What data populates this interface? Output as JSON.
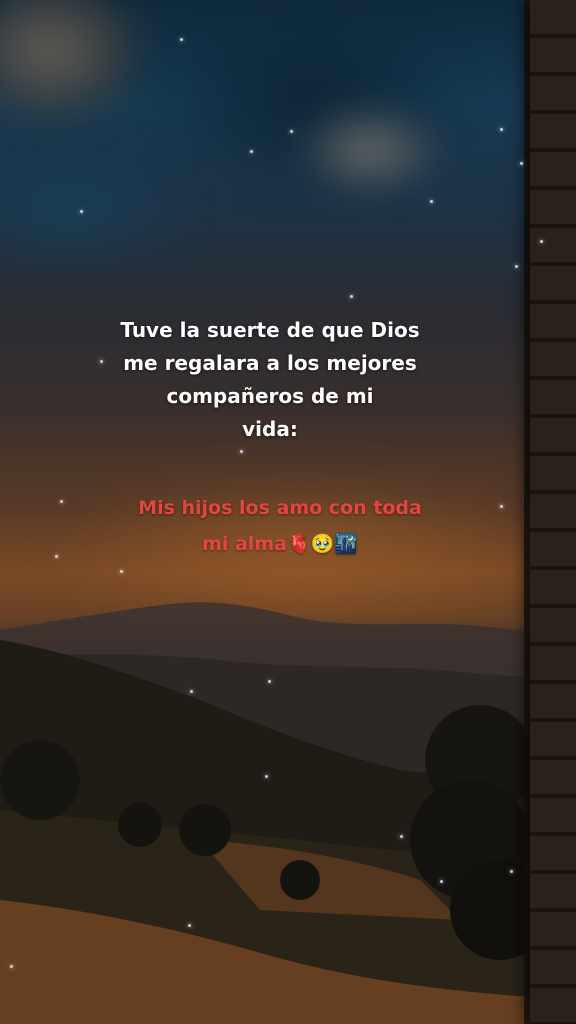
{
  "caption": {
    "lines": [
      "Tuve la suerte de que Dios",
      "me regalara a los mejores",
      "compañeros de mi",
      "vida:"
    ]
  },
  "accent": {
    "lines": [
      "Mis hijos los amo con toda",
      "mi alma🫀🥹🌃"
    ]
  }
}
